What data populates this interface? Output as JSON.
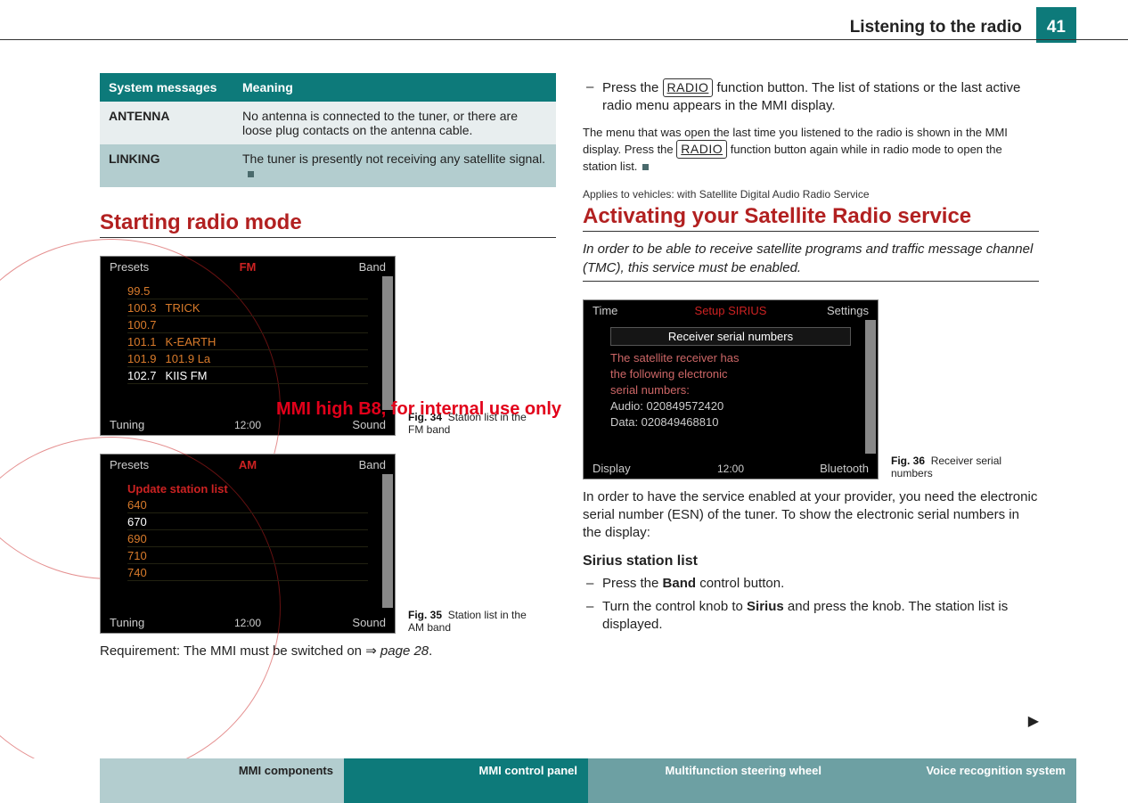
{
  "page": {
    "header_title": "Listening to the radio",
    "page_number": "41"
  },
  "watermark": "MMI high B8, for internal use only",
  "table": {
    "header_col1": "System mes­sages",
    "header_col2": "Meaning",
    "rows": [
      {
        "label": "ANTENNA",
        "meaning": "No antenna is connected to the tuner, or there are loose plug contacts on the antenna cable."
      },
      {
        "label": "LINKING",
        "meaning": "The tuner is presently not receiving any sat­ellite signal."
      }
    ]
  },
  "left": {
    "section_title": "Starting radio mode",
    "fig34": {
      "label": "Fig. 34",
      "caption": "Station list in the FM band",
      "top_center": "FM",
      "corners": {
        "tl": "Presets",
        "tr": "Band",
        "bl": "Tuning",
        "br": "Sound"
      },
      "clock": "12:00",
      "list": [
        {
          "freq": "99.5",
          "name": ""
        },
        {
          "freq": "100.3",
          "name": "TRICK"
        },
        {
          "freq": "100.7",
          "name": ""
        },
        {
          "freq": "101.1",
          "name": "K-EARTH"
        },
        {
          "freq": "101.9",
          "name": "101.9 La"
        },
        {
          "freq": "102.7",
          "name": "KIIS FM",
          "selected": true
        }
      ]
    },
    "fig35": {
      "label": "Fig. 35",
      "caption": "Station list in the AM band",
      "top_center": "AM",
      "corners": {
        "tl": "Presets",
        "tr": "Band",
        "bl": "Tuning",
        "br": "Sound"
      },
      "clock": "12:00",
      "list_head": "Update station list",
      "list": [
        {
          "freq": "640"
        },
        {
          "freq": "670",
          "selected": true
        },
        {
          "freq": "690"
        },
        {
          "freq": "710"
        },
        {
          "freq": "740"
        }
      ]
    },
    "requirement_pre": "Requirement: The MMI must be switched on ",
    "requirement_arrow": "⇒",
    "requirement_ref": " page 28",
    "requirement_post": "."
  },
  "right": {
    "bullet1_pre": "Press the ",
    "bullet1_btn": "RADIO",
    "bullet1_post": " function button. The list of stations or the last active radio menu appears in the MMI display.",
    "para_pre": "The menu that was open the last time you listened to the radio is shown in the MMI display. Press the ",
    "para_btn": "RADIO",
    "para_post": " function button again while in radio mode to open the station list.",
    "applies": "Applies to vehicles: with Satellite Digital Audio Radio Service",
    "section_title": "Activating your Satellite Radio service",
    "intro": "In order to be able to receive satellite programs and traffic message channel (TMC), this service must be enabled.",
    "fig36": {
      "label": "Fig. 36",
      "caption": "Receiver serial numbers",
      "top_center": "Setup SIRIUS",
      "corners": {
        "tl": "Time",
        "tr": "Settings",
        "bl": "Display",
        "br": "Bluetooth"
      },
      "clock": "12:00",
      "box": "Receiver serial numbers",
      "lines": [
        "The satellite receiver has",
        "the following electronic",
        "serial numbers:",
        "Audio: 020849572420",
        "Data: 020849468810"
      ]
    },
    "esn_para": "In order to have the service enabled at your provider, you need the electronic serial number (ESN) of the tuner. To show the electronic serial numbers in the display:",
    "subhead": "Sirius station list",
    "b2_pre": "Press the ",
    "b2_bold": "Band",
    "b2_post": " control button.",
    "b3_pre": "Turn the control knob to ",
    "b3_bold": "Sirius",
    "b3_post": " and press the knob. The station list is displayed."
  },
  "footer": {
    "tab1": "MMI components",
    "tab2": "MMI control panel",
    "tab3": "Multifunction steering wheel",
    "tab4": "Voice recognition system"
  }
}
